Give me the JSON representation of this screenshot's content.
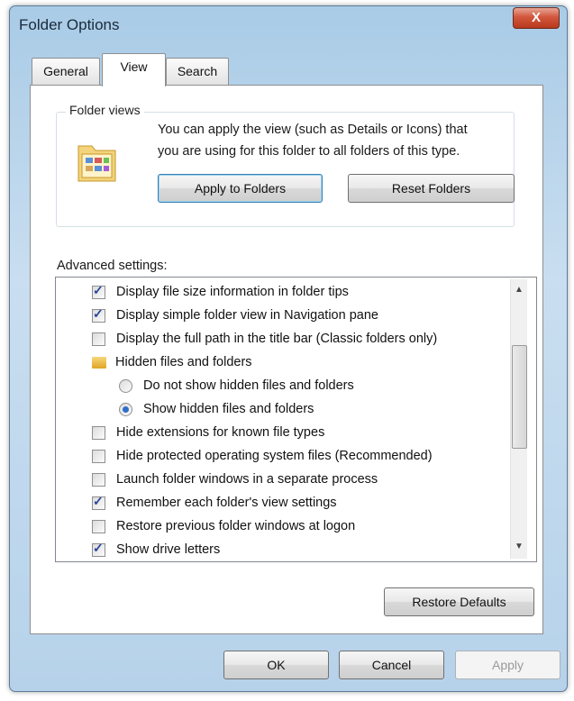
{
  "window": {
    "title": "Folder Options",
    "close_label": "X"
  },
  "tabs": [
    {
      "label": "General",
      "active": false
    },
    {
      "label": "View",
      "active": true
    },
    {
      "label": "Search",
      "active": false
    }
  ],
  "folder_views": {
    "label": "Folder views",
    "description_line1": "You can apply the view (such as Details or Icons) that",
    "description_line2": "you are using for this folder to all folders of this type.",
    "apply_button": "Apply to Folders",
    "reset_button": "Reset Folders"
  },
  "advanced": {
    "label": "Advanced settings:",
    "items": [
      {
        "type": "checkbox",
        "checked": true,
        "label": "Display file size information in folder tips",
        "indent": 1
      },
      {
        "type": "checkbox",
        "checked": true,
        "label": "Display simple folder view in Navigation pane",
        "indent": 1
      },
      {
        "type": "checkbox",
        "checked": false,
        "label": "Display the full path in the title bar (Classic folders only)",
        "indent": 1
      },
      {
        "type": "folder",
        "checked": false,
        "label": "Hidden files and folders",
        "indent": 1
      },
      {
        "type": "radio",
        "checked": false,
        "label": "Do not show hidden files and folders",
        "indent": 2
      },
      {
        "type": "radio",
        "checked": true,
        "label": "Show hidden files and folders",
        "indent": 2
      },
      {
        "type": "checkbox",
        "checked": false,
        "label": "Hide extensions for known file types",
        "indent": 1
      },
      {
        "type": "checkbox",
        "checked": false,
        "label": "Hide protected operating system files (Recommended)",
        "indent": 1
      },
      {
        "type": "checkbox",
        "checked": false,
        "label": "Launch folder windows in a separate process",
        "indent": 1
      },
      {
        "type": "checkbox",
        "checked": true,
        "label": "Remember each folder's view settings",
        "indent": 1
      },
      {
        "type": "checkbox",
        "checked": false,
        "label": "Restore previous folder windows at logon",
        "indent": 1
      },
      {
        "type": "checkbox",
        "checked": true,
        "label": "Show drive letters",
        "indent": 1
      }
    ],
    "restore_button": "Restore Defaults"
  },
  "footer": {
    "ok": "OK",
    "cancel": "Cancel",
    "apply": "Apply"
  },
  "colors": {
    "frame": "#b6d2ea",
    "close": "#d2573d",
    "accent": "#3c7fb1"
  },
  "icons": {
    "folder": "folder-options-icon",
    "scroll_up": "chevron-up-icon",
    "scroll_down": "chevron-down-icon"
  }
}
